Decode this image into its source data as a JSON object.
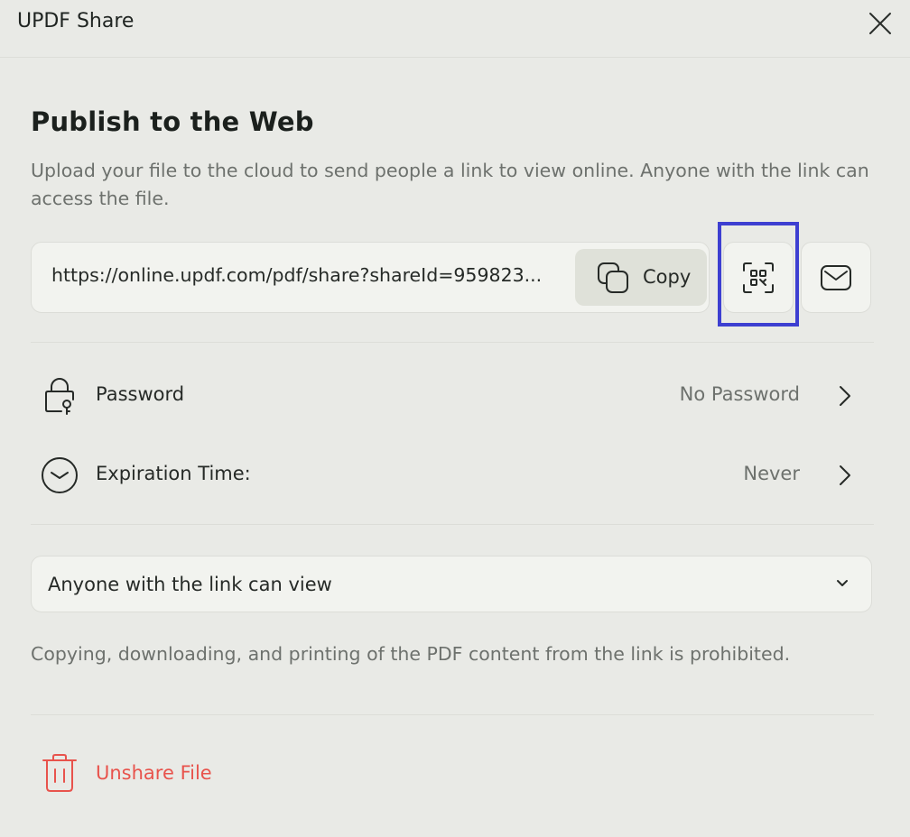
{
  "window": {
    "title": "UPDF Share",
    "close_icon": "close-icon"
  },
  "publish": {
    "heading": "Publish to the Web",
    "description": "Upload your file to the cloud to send people a link to view online. Anyone with the link can access the file."
  },
  "link": {
    "url": "https://online.updf.com/pdf/share?shareId=959823...",
    "copy_label": "Copy",
    "copy_icon": "copy-icon",
    "qr_icon": "qr-code-icon",
    "mail_icon": "mail-icon"
  },
  "settings": {
    "password": {
      "label": "Password",
      "value": "No Password",
      "icon": "lock-key-icon"
    },
    "expiration": {
      "label": "Expiration Time:",
      "value": "Never",
      "icon": "clock-icon"
    }
  },
  "access": {
    "selected": "Anyone with the link can view",
    "notice": "Copying, downloading, and printing of the PDF content from the link is prohibited."
  },
  "unshare": {
    "label": "Unshare File",
    "icon": "trash-icon"
  },
  "colors": {
    "background": "#e9eae6",
    "panel": "#f2f3ef",
    "danger": "#e8534c",
    "highlight": "#3d3fd1"
  }
}
